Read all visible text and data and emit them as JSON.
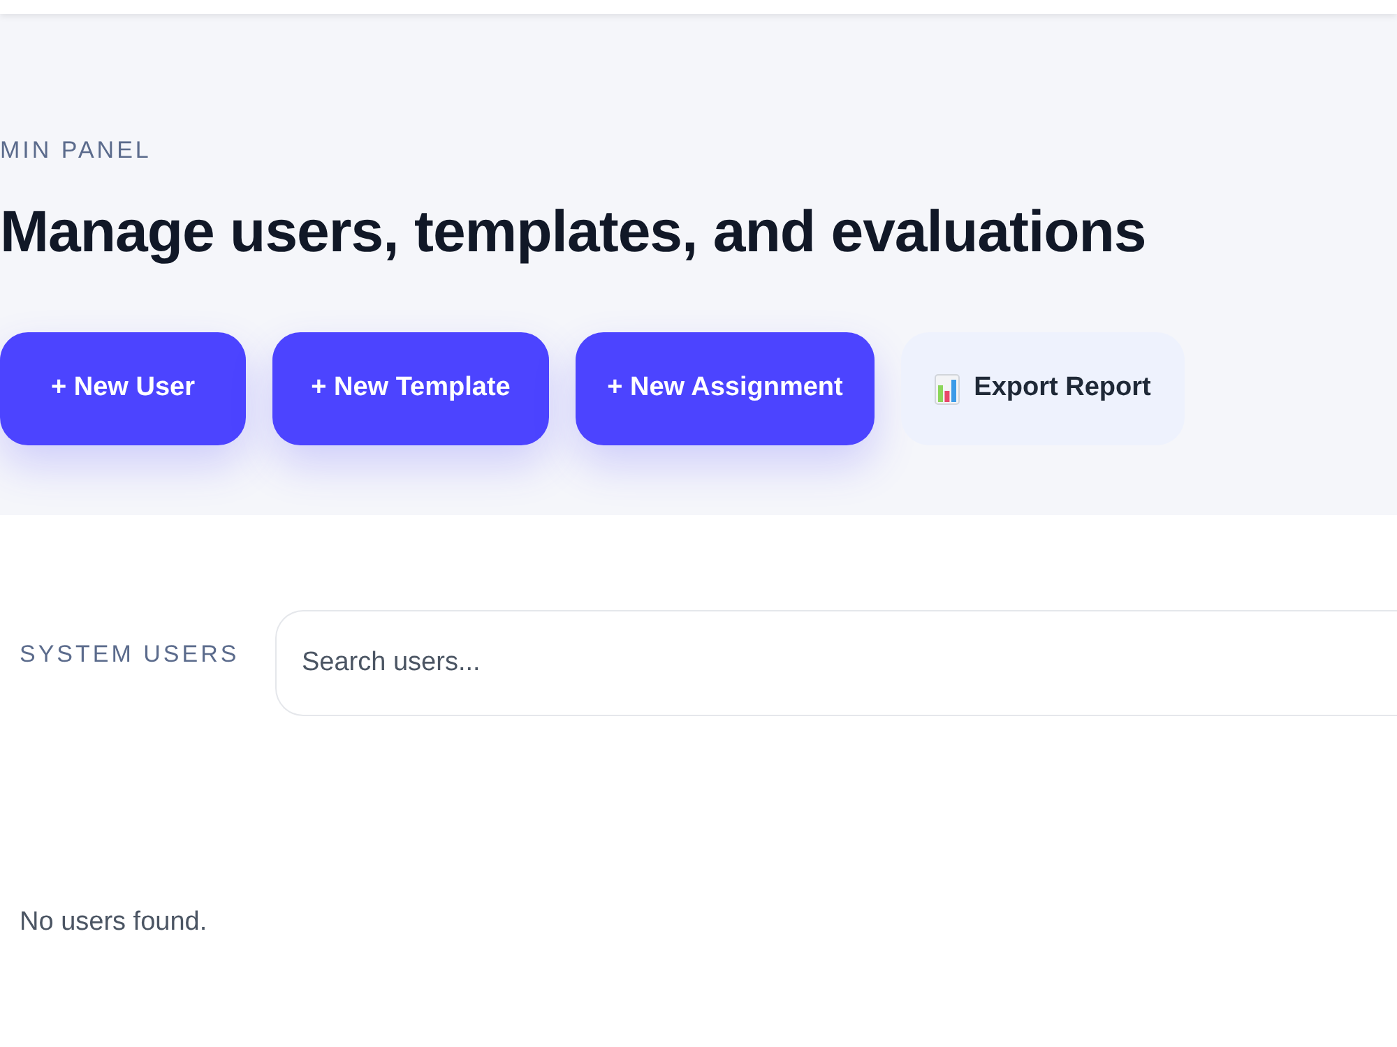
{
  "header": {
    "eyebrow": "MIN PANEL",
    "title": "Manage users, templates, and evaluations"
  },
  "actions": [
    {
      "label": "+ New User",
      "kind": "primary"
    },
    {
      "label": "+ New Template",
      "kind": "primary"
    },
    {
      "label": "+ New Assignment",
      "kind": "primary"
    },
    {
      "label": "Export Report",
      "kind": "secondary"
    }
  ],
  "users_panel": {
    "title": "SYSTEM USERS",
    "search": {
      "placeholder": "Search users..."
    },
    "empty_message": "No users found."
  }
}
